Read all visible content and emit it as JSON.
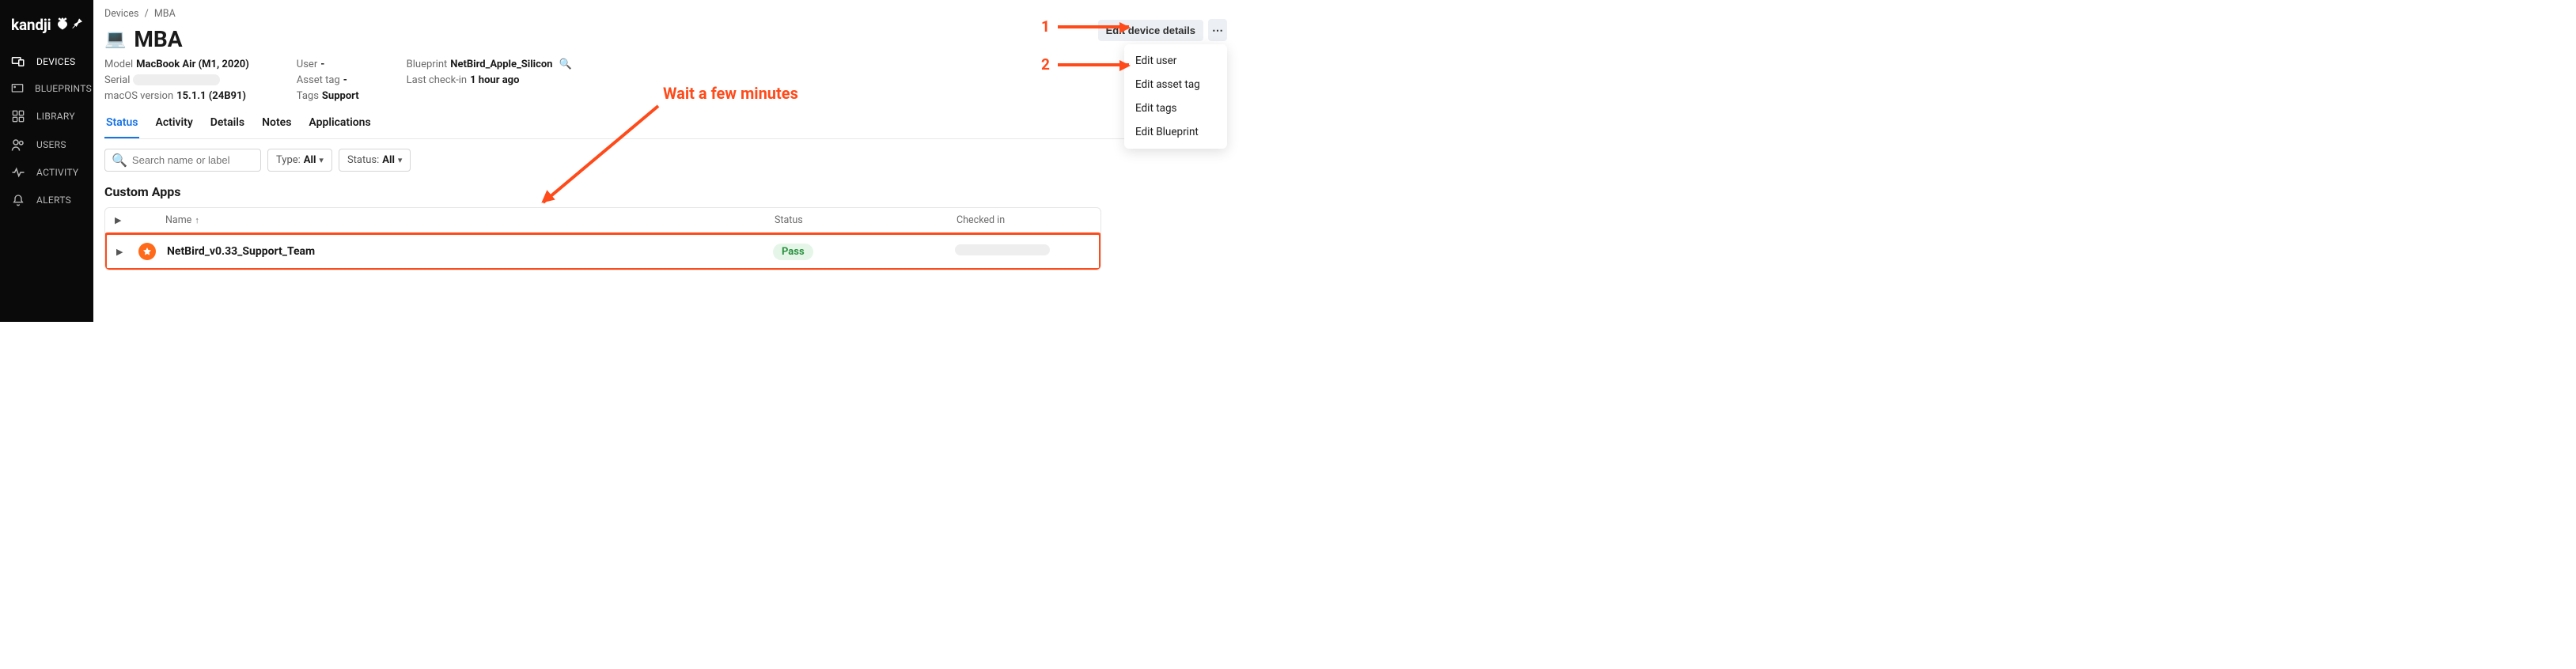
{
  "brand": {
    "name": "kandji"
  },
  "sidebar": {
    "items": [
      {
        "label": "DEVICES",
        "icon": "devices-icon",
        "active": true
      },
      {
        "label": "BLUEPRINTS",
        "icon": "blueprints-icon",
        "active": false
      },
      {
        "label": "LIBRARY",
        "icon": "library-icon",
        "active": false
      },
      {
        "label": "USERS",
        "icon": "users-icon",
        "active": false
      },
      {
        "label": "ACTIVITY",
        "icon": "activity-icon",
        "active": false
      },
      {
        "label": "ALERTS",
        "icon": "alerts-icon",
        "active": false
      }
    ]
  },
  "breadcrumb": {
    "root": "Devices",
    "current": "MBA"
  },
  "page": {
    "title": "MBA",
    "device_icon": "💻"
  },
  "info": {
    "model_label": "Model",
    "model_value": "MacBook Air (M1, 2020)",
    "serial_label": "Serial",
    "osver_label": "macOS version",
    "osver_value": "15.1.1 (24B91)",
    "user_label": "User",
    "user_value": "-",
    "assettag_label": "Asset tag",
    "assettag_value": "-",
    "tags_label": "Tags",
    "tags_value": "Support",
    "blueprint_label": "Blueprint",
    "blueprint_value": "NetBird_Apple_Silicon",
    "lastcheck_label": "Last check-in",
    "lastcheck_value": "1 hour ago"
  },
  "actions": {
    "edit_details": "Edit device details",
    "menu": [
      "Edit user",
      "Edit asset tag",
      "Edit tags",
      "Edit Blueprint"
    ]
  },
  "tabs": [
    "Status",
    "Activity",
    "Details",
    "Notes",
    "Applications"
  ],
  "active_tab": "Status",
  "toolbar": {
    "search_placeholder": "Search name or label",
    "type_label": "Type:",
    "type_value": "All",
    "status_label": "Status:",
    "status_value": "All"
  },
  "section_title": "Custom Apps",
  "table": {
    "headers": {
      "name": "Name",
      "status": "Status",
      "checked": "Checked in"
    },
    "rows": [
      {
        "name": "NetBird_v0.33_Support_Team",
        "status": "Pass"
      }
    ]
  },
  "annotations": {
    "step1": "1",
    "step2": "2",
    "wait": "Wait a few minutes"
  },
  "colors": {
    "accent": "#1773e6",
    "highlight": "#ff4a1a",
    "pass_bg": "#e5f6e8",
    "pass_fg": "#2a9140"
  }
}
